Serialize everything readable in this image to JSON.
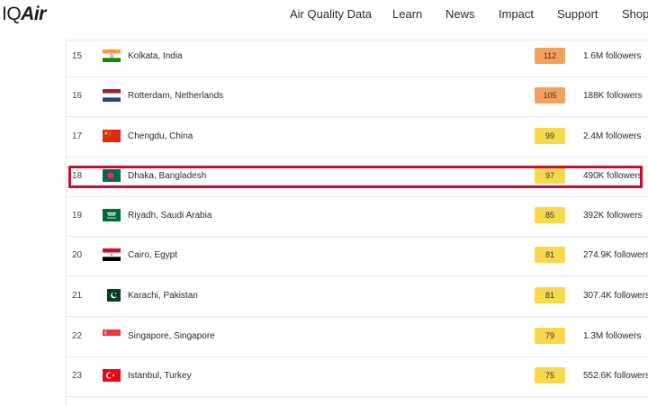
{
  "logo": {
    "iq": "IQ",
    "air": "Air"
  },
  "nav": {
    "items": [
      "Air Quality Data",
      "Learn",
      "News",
      "Impact",
      "Support",
      "Shop"
    ]
  },
  "ranking": {
    "rows": [
      {
        "rank": "15",
        "city": "Kolkata, India",
        "flag": "india-flag",
        "aqi": "112",
        "aqi_color": "#f5a15c",
        "followers": "1.6M followers"
      },
      {
        "rank": "16",
        "city": "Rotterdam, Netherlands",
        "flag": "netherlands-flag",
        "aqi": "105",
        "aqi_color": "#f5a15c",
        "followers": "188K followers"
      },
      {
        "rank": "17",
        "city": "Chengdu, China",
        "flag": "china-flag",
        "aqi": "99",
        "aqi_color": "#f7d94c",
        "followers": "2.4M followers"
      },
      {
        "rank": "18",
        "city": "Dhaka, Bangladesh",
        "flag": "bangladesh-flag",
        "aqi": "97",
        "aqi_color": "#f7d94c",
        "followers": "490K followers",
        "highlighted": true
      },
      {
        "rank": "19",
        "city": "Riyadh, Saudi Arabia",
        "flag": "saudi-arabia-flag",
        "aqi": "85",
        "aqi_color": "#f7d94c",
        "followers": "392K followers"
      },
      {
        "rank": "20",
        "city": "Cairo, Egypt",
        "flag": "egypt-flag",
        "aqi": "81",
        "aqi_color": "#f7d94c",
        "followers": "274.9K followers"
      },
      {
        "rank": "21",
        "city": "Karachi, Pakistan",
        "flag": "pakistan-flag",
        "aqi": "81",
        "aqi_color": "#f7d94c",
        "followers": "307.4K followers"
      },
      {
        "rank": "22",
        "city": "Singapore, Singapore",
        "flag": "singapore-flag",
        "aqi": "79",
        "aqi_color": "#f7d94c",
        "followers": "1.3M followers"
      },
      {
        "rank": "23",
        "city": "Istanbul, Turkey",
        "flag": "turkey-flag",
        "aqi": "75",
        "aqi_color": "#f7d94c",
        "followers": "552.6K followers"
      }
    ],
    "highlight_color": "#c8102e"
  }
}
